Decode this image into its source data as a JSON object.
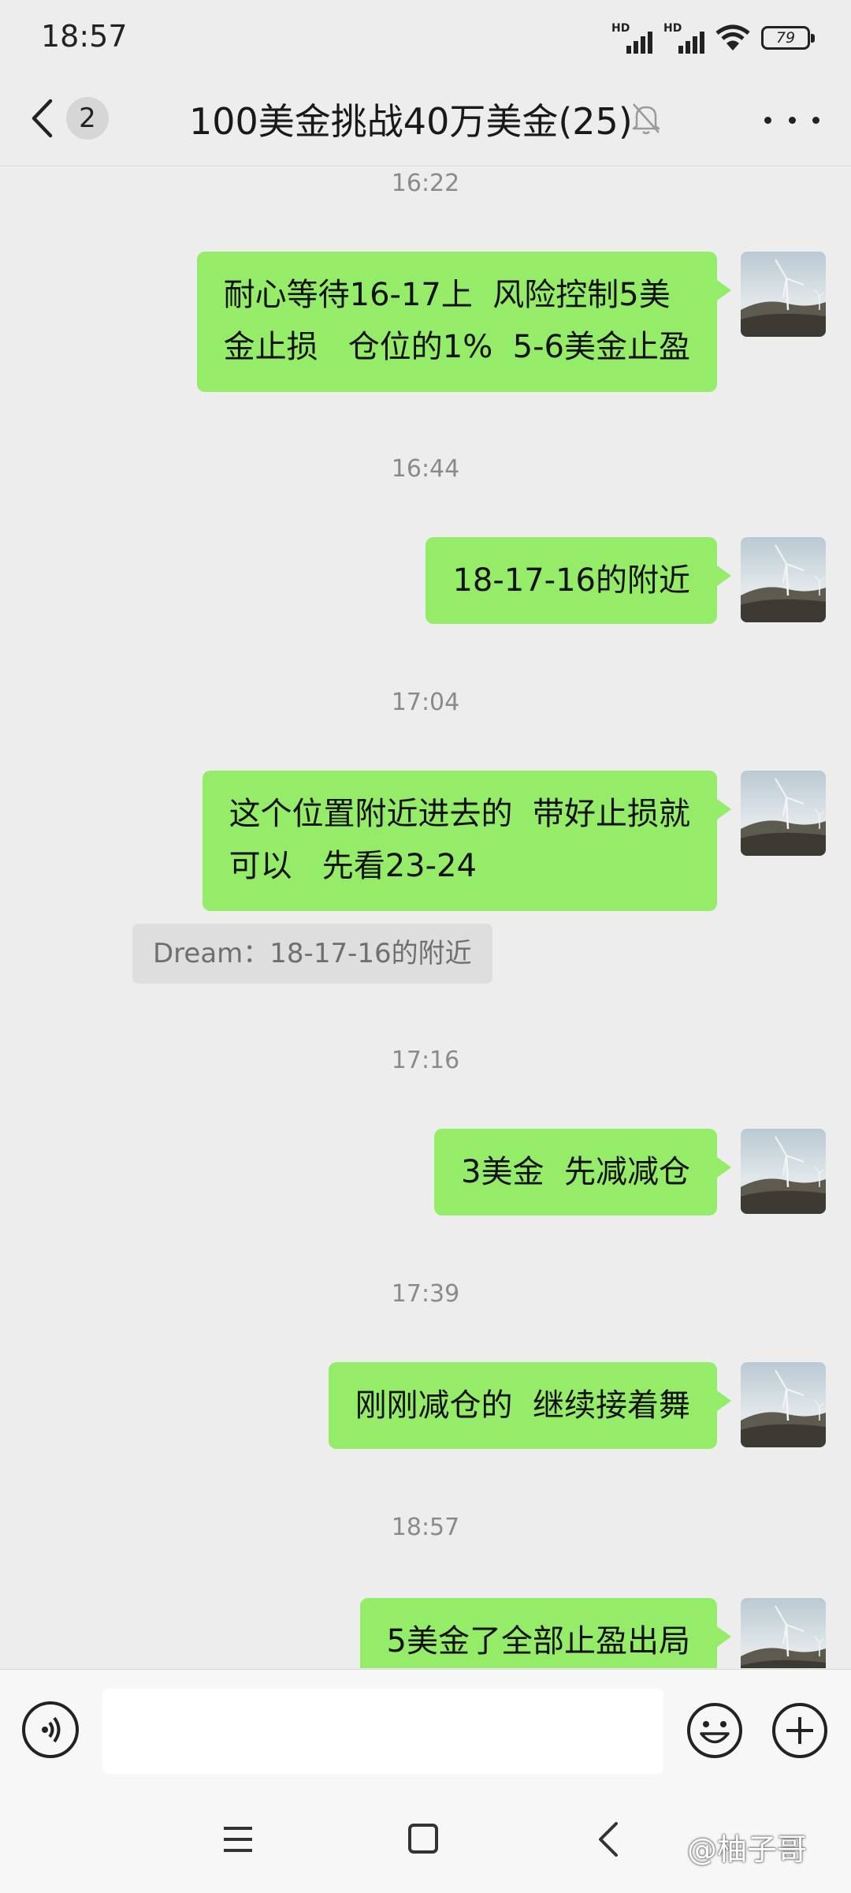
{
  "status_bar": {
    "time": "18:57",
    "signal_label_1": "HD",
    "signal_label_2": "HD",
    "battery": "79"
  },
  "header": {
    "unread_count": "2",
    "title": "100美金挑战40万美金(25)"
  },
  "messages": [
    {
      "timestamp": "16:22",
      "text": "耐心等待16-17上  风险控制5美\n金止损   仓位的1%  5-6美金止盈"
    },
    {
      "timestamp": "16:44",
      "text": "18-17-16的附近"
    },
    {
      "timestamp": "17:04",
      "text": "这个位置附近进去的  带好止损就\n可以   先看23-24",
      "quote": "Dream：18-17-16的附近"
    },
    {
      "timestamp": "17:16",
      "text": "3美金  先减减仓"
    },
    {
      "timestamp": "17:39",
      "text": "刚刚减仓的  继续接着舞"
    },
    {
      "timestamp": "18:57",
      "text": "5美金了全部止盈出局"
    }
  ],
  "input": {
    "placeholder": ""
  },
  "watermark": "@柚子哥",
  "colors": {
    "bubble": "#95ec69",
    "background": "#ededed",
    "quote_bg": "#dedede"
  }
}
